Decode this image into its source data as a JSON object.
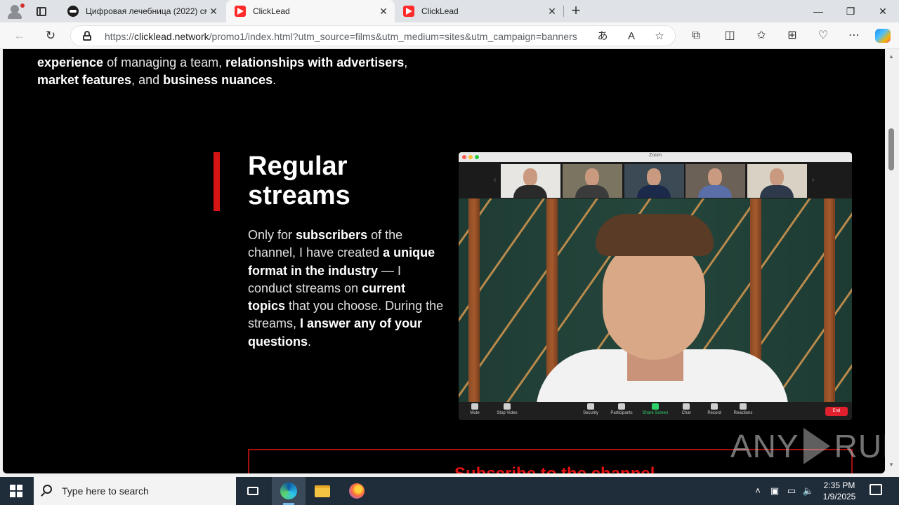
{
  "browser": {
    "tabs": [
      {
        "title": "Цифровая лечебница (2022) см",
        "active": false
      },
      {
        "title": "ClickLead",
        "active": true
      },
      {
        "title": "ClickLead",
        "active": false
      }
    ],
    "url_prefix": "https://",
    "url_host": "clicklead.network",
    "url_path": "/promo1/index.html?utm_source=films&utm_medium=sites&utm_campaign=banners"
  },
  "page": {
    "intro_line1": [
      {
        "text": "experience",
        "bold": true
      },
      {
        "text": " of managing a team, ",
        "bold": false
      },
      {
        "text": "relationships with advertisers",
        "bold": true
      },
      {
        "text": ",",
        "bold": false
      }
    ],
    "intro_line2": [
      {
        "text": "market features",
        "bold": true
      },
      {
        "text": ", and ",
        "bold": false
      },
      {
        "text": "business nuances",
        "bold": true
      },
      {
        "text": ".",
        "bold": false
      }
    ],
    "section_title": "Regular streams",
    "section_body": [
      {
        "text": "Only for ",
        "bold": false
      },
      {
        "text": "subscribers",
        "bold": true
      },
      {
        "text": " of the channel, I have created ",
        "bold": false
      },
      {
        "text": "a unique format in the industry",
        "bold": true
      },
      {
        "text": " — I conduct streams on ",
        "bold": false
      },
      {
        "text": "current topics",
        "bold": true
      },
      {
        "text": " that you choose. During the streams, ",
        "bold": false
      },
      {
        "text": "I answer any of your questions",
        "bold": true
      },
      {
        "text": ".",
        "bold": false
      }
    ],
    "zoom": {
      "window_title": "Zoom",
      "controls": [
        "Mute",
        "Stop Video",
        "Security",
        "Participants",
        "Share Screen",
        "Chat",
        "Record",
        "Reactions"
      ],
      "end_label": "End"
    },
    "subscribe_label": "Subscribe to the channel",
    "watermark": "ANY RUN"
  },
  "taskbar": {
    "search_placeholder": "Type here to search",
    "time": "2:35 PM",
    "date": "1/9/2025"
  },
  "colors": {
    "accent_red": "#d71414",
    "page_bg": "#000000",
    "taskbar_bg": "#1f2c3a"
  }
}
